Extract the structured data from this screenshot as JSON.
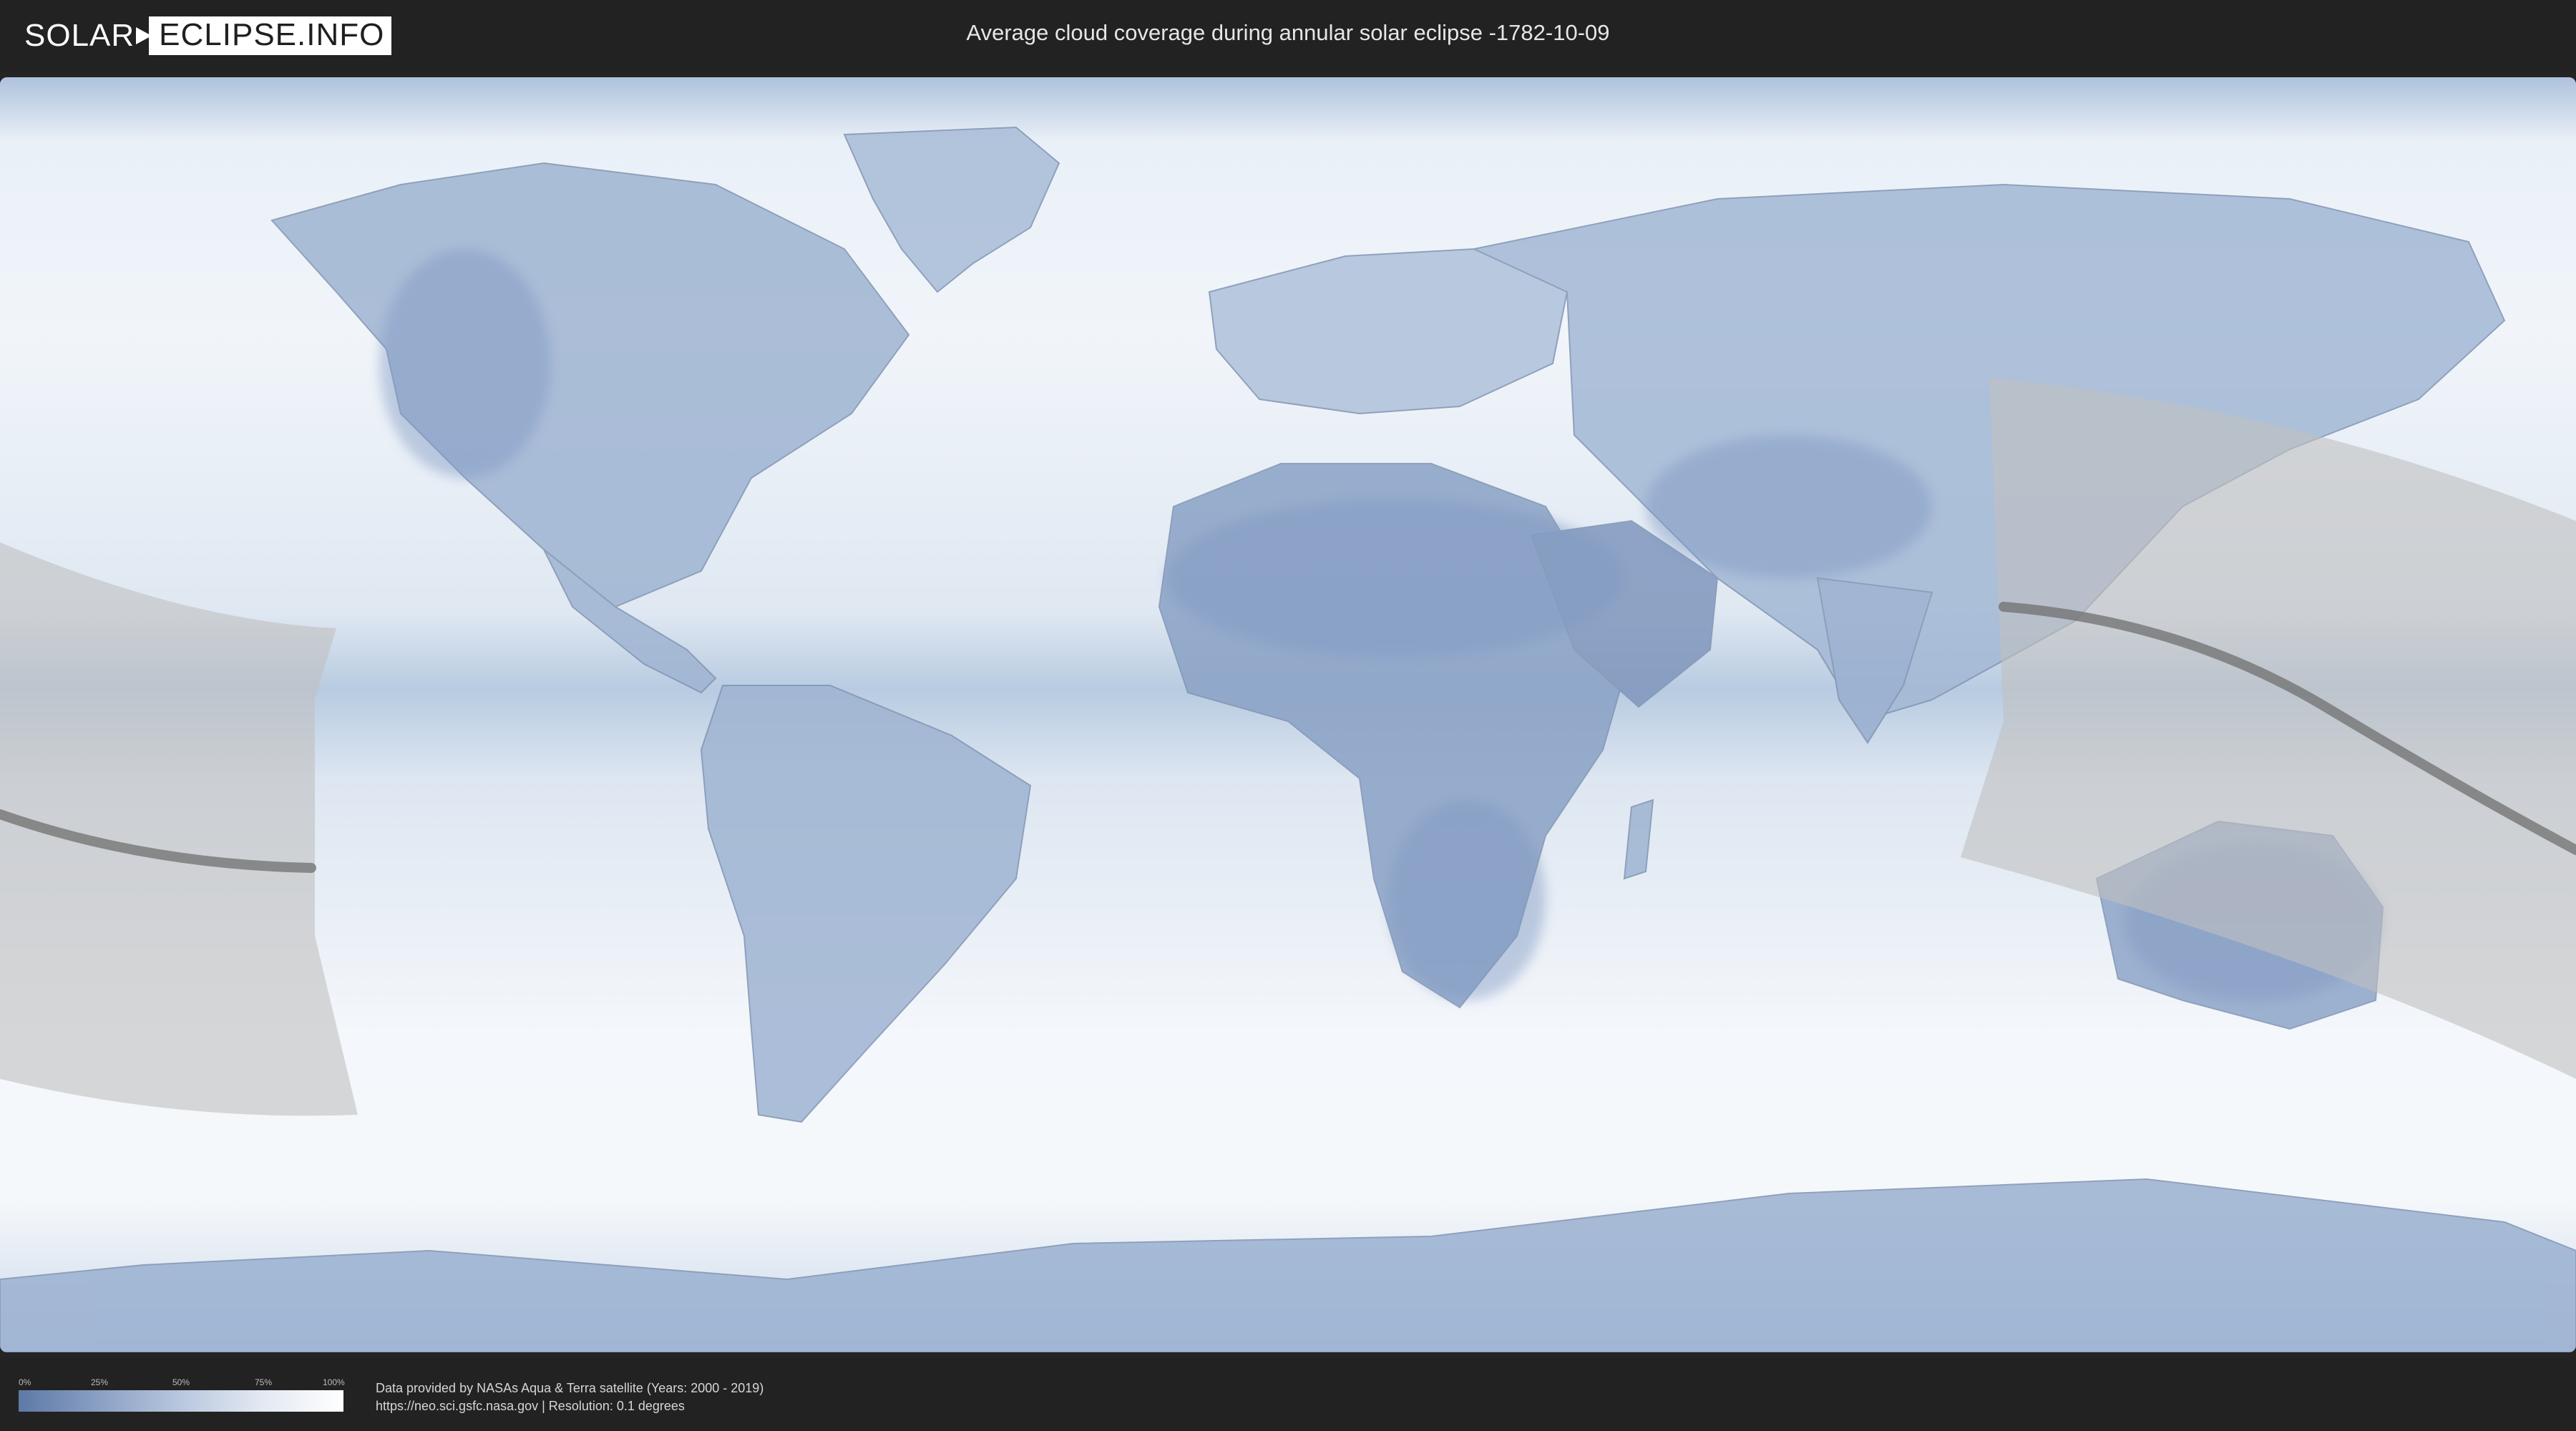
{
  "header": {
    "logo_left": "SOLAR",
    "logo_right": "ECLIPSE.INFO",
    "title": "Average cloud coverage during annular solar eclipse -1782-10-09"
  },
  "legend": {
    "ticks": [
      "0%",
      "25%",
      "50%",
      "75%",
      "100%"
    ],
    "colors": {
      "low": "#5e79a8",
      "high": "#ffffff"
    }
  },
  "footer": {
    "source_line": "Data provided by NASAs Aqua & Terra satellite (Years: 2000 - 2019)",
    "url_line": "https://neo.sci.gsfc.nasa.gov | Resolution: 0.1 degrees"
  },
  "map": {
    "visible_zone_color": "#bfbfbf",
    "eclipse_path_color": "#6f6f6f",
    "ocean_cloud_color": "#eef3f9",
    "clear_sky_color": "#7f98c2"
  }
}
